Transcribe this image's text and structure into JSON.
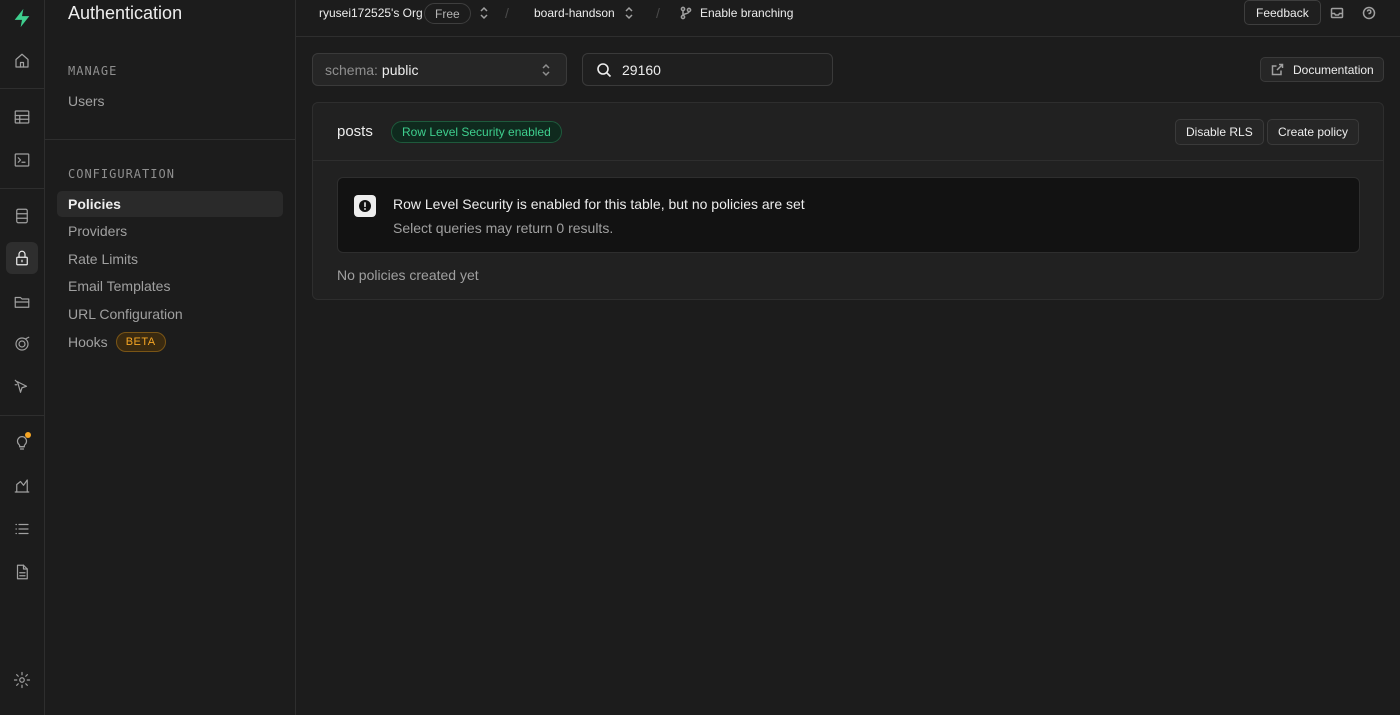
{
  "rail": {
    "icons": [
      "supabase-logo-icon",
      "home-icon",
      "table-editor-icon",
      "sql-editor-icon",
      "database-icon",
      "authentication-icon",
      "storage-icon",
      "realtime-icon",
      "edge-functions-icon",
      "advisors-icon",
      "reports-icon",
      "logs-icon",
      "api-docs-icon",
      "settings-icon"
    ],
    "active": "authentication-icon",
    "accent_color": "#3ecf8e",
    "notification_color": "#f5a524"
  },
  "menu": {
    "title": "Authentication",
    "sections": [
      {
        "heading": "MANAGE",
        "items": [
          "Users"
        ]
      },
      {
        "heading": "CONFIGURATION",
        "items": [
          "Policies",
          "Providers",
          "Rate Limits",
          "Email Templates",
          "URL Configuration",
          "Hooks"
        ]
      }
    ],
    "active_item": "Policies",
    "hooks_badge": "BETA"
  },
  "header": {
    "org": "ryusei172525's Org",
    "plan": "Free",
    "project": "board-handson",
    "separator": "/",
    "branching": "Enable branching",
    "feedback": "Feedback"
  },
  "main": {
    "schema_label": "schema:",
    "schema_value": "public",
    "search_value": "29160",
    "documentation": "Documentation",
    "table": {
      "name": "posts",
      "rls_badge": "Row Level Security enabled",
      "disable_rls": "Disable RLS",
      "create_policy": "Create policy",
      "alert_title": "Row Level Security is enabled for this table, but no policies are set",
      "alert_desc": "Select queries may return 0 results.",
      "empty_text": "No policies created yet"
    }
  }
}
